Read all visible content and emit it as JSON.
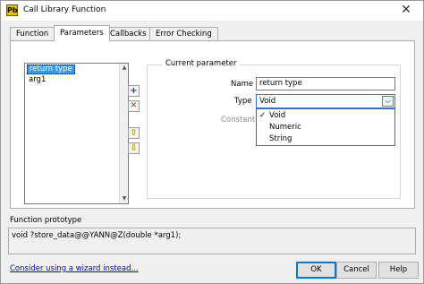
{
  "window": {
    "title": "Call Library Function",
    "app_icon_text": "Pb",
    "close_glyph": "✕"
  },
  "tabs": [
    {
      "label": "Function"
    },
    {
      "label": "Parameters"
    },
    {
      "label": "Callbacks"
    },
    {
      "label": "Error Checking"
    }
  ],
  "active_tab": "Parameters",
  "parameters_list": {
    "items": [
      "return type",
      "arg1"
    ],
    "selected": "return type"
  },
  "side_buttons": {
    "add_glyph": "+",
    "delete_glyph": "✕",
    "up_glyph": "⇧",
    "down_glyph": "⇩"
  },
  "current_parameter": {
    "group_title": "Current parameter",
    "name_label": "Name",
    "name_value": "return type",
    "type_label": "Type",
    "type_value": "Void",
    "type_arrow": "⌵",
    "constant_label": "Constant",
    "type_options": [
      "Void",
      "Numeric",
      "String"
    ],
    "checked_option": "Void",
    "check_glyph": "✓"
  },
  "function_prototype": {
    "label": "Function prototype",
    "value": "void  ?store_data@@YANN@Z(double *arg1);"
  },
  "footer": {
    "wizard_link": "Consider using a wizard instead...",
    "ok_label": "OK",
    "cancel_label": "Cancel",
    "help_label": "Help"
  }
}
